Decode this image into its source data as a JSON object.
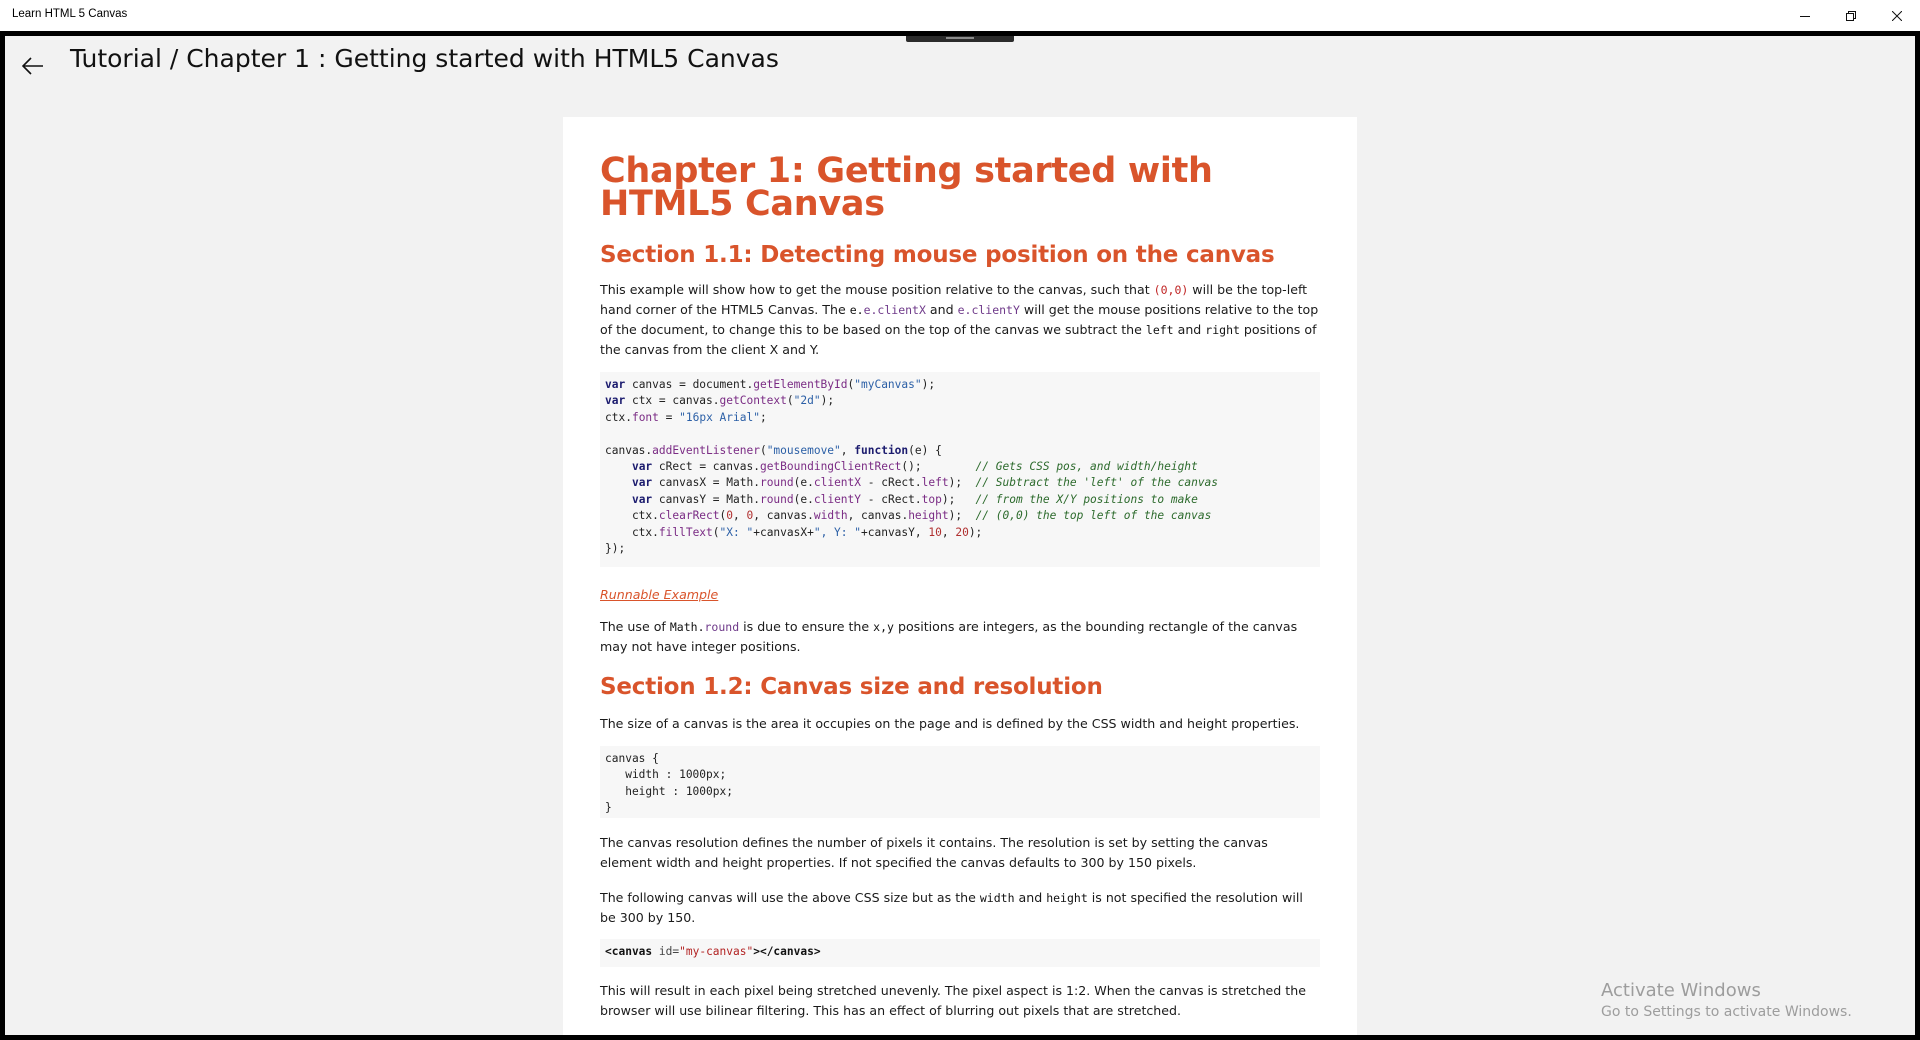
{
  "window": {
    "title": "Learn HTML 5 Canvas"
  },
  "header": {
    "breadcrumb": "Tutorial / Chapter 1 :  Getting started with HTML5 Canvas"
  },
  "article": {
    "chapter_title": "Chapter 1: Getting started with HTML5 Canvas",
    "section1": {
      "title": "Section 1.1: Detecting mouse position on the canvas",
      "para1": {
        "t1": "This example will show how to get the mouse position relative to the canvas, such that ",
        "c1": "(0,0)",
        "t2": " will be the top-left hand corner of the HTML5 Canvas. The ",
        "c2": "e.clientX",
        "t3": " and ",
        "c3": "e.clientY",
        "t4": " will get the mouse positions relative to the top of the document, to change this to be based on the top of the canvas we subtract the ",
        "c4": "left",
        "t5": " and ",
        "c5": "right",
        "t6": " positions of the canvas from the client X and Y."
      },
      "runnable_link": "Runnable Example",
      "para2": {
        "t1": "The use of ",
        "c1": "Math.round",
        "t2": " is due to ensure the ",
        "c2": "x,y",
        "t3": " positions are integers, as the bounding rectangle of the canvas may not have integer positions."
      }
    },
    "section2": {
      "title": "Section 1.2: Canvas size and resolution",
      "para1": "The size of a canvas is the area it occupies on the page and is defined by the CSS width and height properties.",
      "para2": "The canvas resolution defines the number of pixels it contains. The resolution is set by setting the canvas element width and height properties. If not specified the canvas defaults to 300 by 150 pixels.",
      "para3": {
        "t1": "The following canvas will use the above CSS size but as the ",
        "c1": "width",
        "t2": " and ",
        "c2": "height",
        "t3": " is not specified the resolution will be 300 by 150."
      },
      "para4": "This will result in each pixel being stretched unevenly. The pixel aspect is 1:2. When the canvas is stretched the browser will use bilinear filtering. This has an effect of blurring out pixels that are stretched."
    }
  },
  "watermark": {
    "title": "Activate Windows",
    "subtitle": "Go to Settings to activate Windows."
  },
  "icons": {
    "back": "arrow-left-icon",
    "minimize": "minimize-icon",
    "restore": "restore-icon",
    "close": "close-icon"
  }
}
